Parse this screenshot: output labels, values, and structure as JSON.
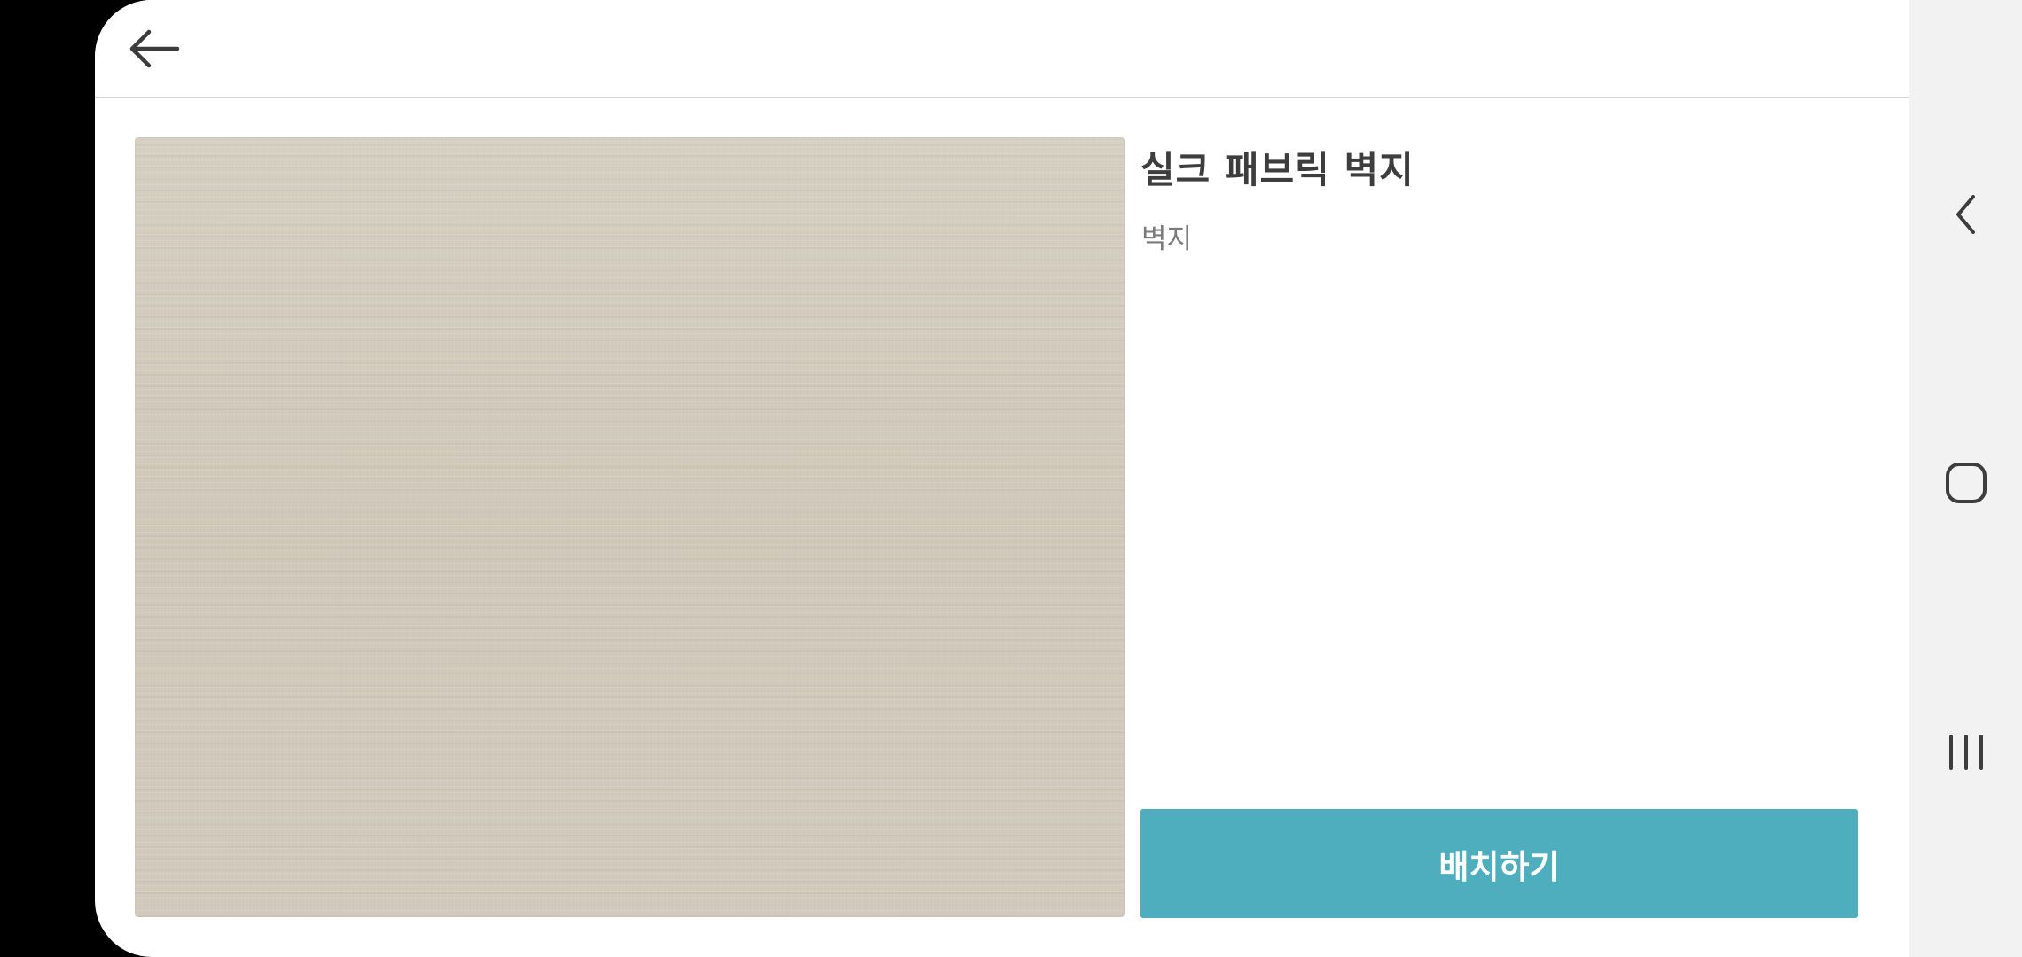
{
  "app": {
    "toolbar": {
      "back_icon": "arrow-left-icon"
    },
    "product": {
      "title": "실크 패브릭 벽지",
      "category": "벽지",
      "image_description_color": "#d2cbbd"
    },
    "actions": {
      "place_label": "배치하기",
      "place_color": "#4faebe"
    }
  },
  "system_nav": {
    "back_icon": "chevron-left-icon",
    "home_icon": "rounded-square-icon",
    "recents_icon": "three-bars-icon"
  }
}
